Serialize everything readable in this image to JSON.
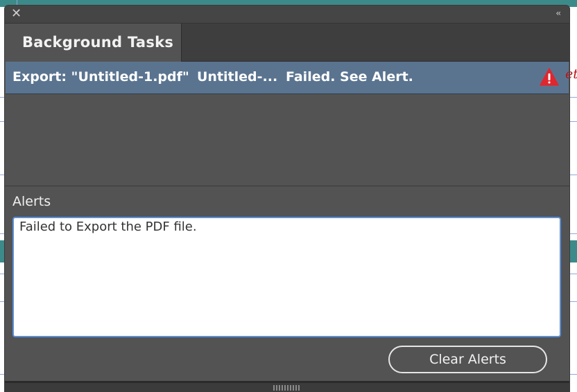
{
  "panel": {
    "close_glyph": "✕",
    "collapse_glyph": "‹‹",
    "tab_label": "Background Tasks"
  },
  "tasks": [
    {
      "name": "Export: \"Untitled-1.pdf\"",
      "document": "Untitled-...",
      "status": "Failed. See Alert.",
      "icon": "warning-icon"
    }
  ],
  "alerts": {
    "label": "Alerts",
    "message": "Failed to Export the PDF file."
  },
  "buttons": {
    "clear_alerts": "Clear Alerts"
  },
  "colors": {
    "panel_bg": "#535353",
    "selected_row": "#5a7490",
    "warning": "#e0262e",
    "focus_border": "#5b8fd8"
  }
}
